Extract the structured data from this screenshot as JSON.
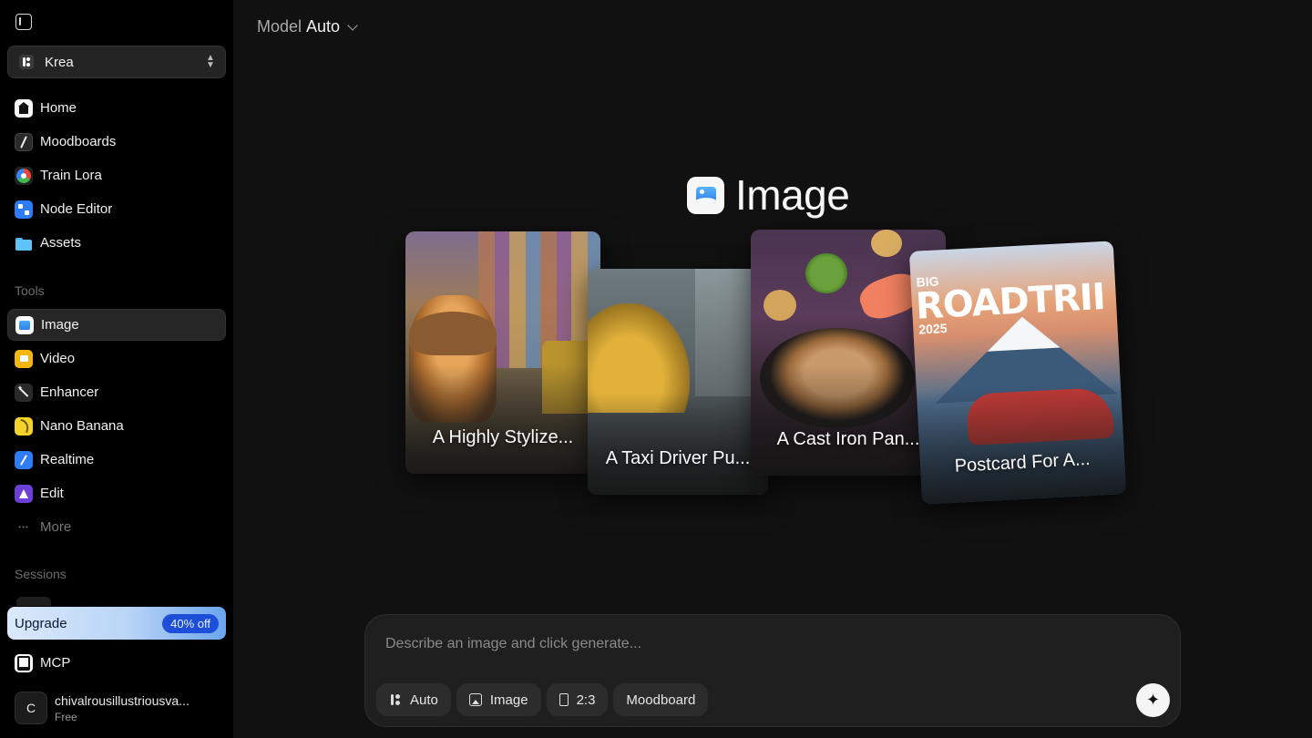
{
  "workspace": {
    "name": "Krea"
  },
  "nav": [
    {
      "label": "Home",
      "icon": "home-icon"
    },
    {
      "label": "Moodboards",
      "icon": "moodboard-icon"
    },
    {
      "label": "Train Lora",
      "icon": "lora-icon"
    },
    {
      "label": "Node Editor",
      "icon": "node-editor-icon"
    },
    {
      "label": "Assets",
      "icon": "folder-icon"
    }
  ],
  "tools_label": "Tools",
  "tools": [
    {
      "label": "Image",
      "icon": "image-icon",
      "active": true
    },
    {
      "label": "Video",
      "icon": "video-icon"
    },
    {
      "label": "Enhancer",
      "icon": "magic-wand-icon"
    },
    {
      "label": "Nano Banana",
      "icon": "banana-icon"
    },
    {
      "label": "Realtime",
      "icon": "pen-icon"
    },
    {
      "label": "Edit",
      "icon": "edit-icon"
    },
    {
      "label": "More",
      "icon": "more-icon"
    }
  ],
  "sessions_label": "Sessions",
  "upgrade": {
    "label": "Upgrade",
    "badge": "40% off"
  },
  "mcp": {
    "label": "MCP"
  },
  "user": {
    "initial": "C",
    "name": "chivalrousillustriousva...",
    "plan": "Free"
  },
  "model": {
    "label": "Model",
    "value": "Auto"
  },
  "hero": {
    "title": "Image"
  },
  "examples": [
    {
      "label": "A Highly Stylize..."
    },
    {
      "label": "A Taxi Driver Pu..."
    },
    {
      "label": "A Cast Iron Pan..."
    },
    {
      "label": "Postcard For A...",
      "poster_top": "BIG",
      "poster_title": "ROADTRII",
      "poster_year": "2025"
    }
  ],
  "prompt": {
    "placeholder": "Describe an image and click generate...",
    "chips": [
      "Auto",
      "Image",
      "2:3",
      "Moodboard"
    ]
  },
  "colors": {
    "accent": "#2f7df6",
    "upgrade_badge": "#1d4ed8",
    "background": "#111111",
    "sidebar": "#000000"
  }
}
